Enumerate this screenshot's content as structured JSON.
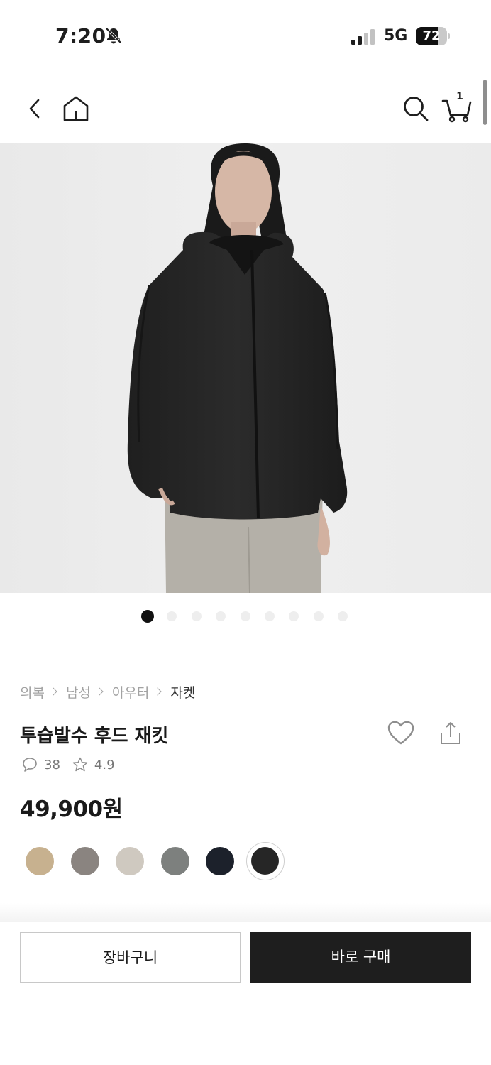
{
  "status_bar": {
    "time": "7:20",
    "network": "5G",
    "battery_percent": "72",
    "battery_level": 0.72
  },
  "header": {
    "cart_count": "1"
  },
  "carousel": {
    "total": 9,
    "active_index": 0
  },
  "breadcrumb": [
    "의복",
    "남성",
    "아우터",
    "자켓"
  ],
  "product": {
    "title": "투습발수 후드 재킷",
    "review_count": "38",
    "rating": "4.9",
    "price": "49,900원"
  },
  "colors": {
    "swatches": [
      "#c7b18f",
      "#8a8480",
      "#cfc9c0",
      "#7d807e",
      "#1c212b",
      "#262626"
    ],
    "selected_index": 5
  },
  "actions": {
    "cart_label": "장바구니",
    "buy_label": "바로 구매"
  }
}
